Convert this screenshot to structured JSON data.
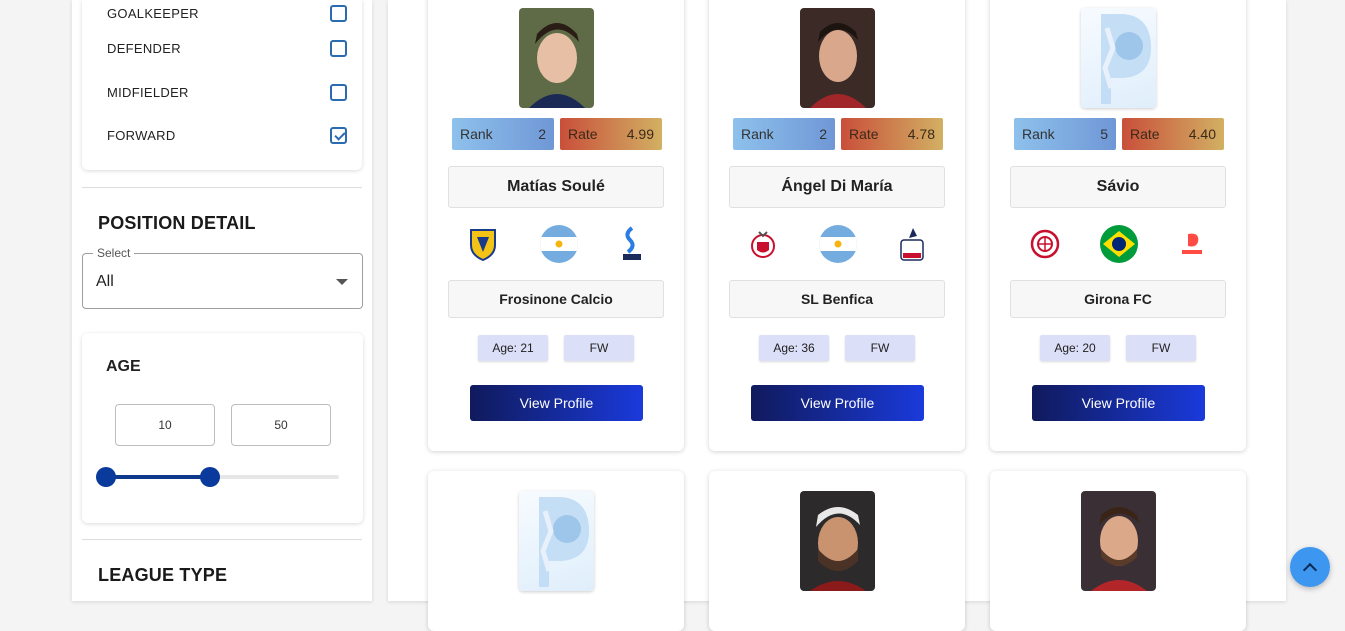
{
  "filters": {
    "positions": [
      {
        "label": "GOALKEEPER",
        "checked": false
      },
      {
        "label": "DEFENDER",
        "checked": false
      },
      {
        "label": "MIDFIELDER",
        "checked": false
      },
      {
        "label": "FORWARD",
        "checked": true
      }
    ],
    "position_detail": {
      "title": "POSITION DETAIL",
      "select_label": "Select",
      "select_value": "All"
    },
    "age": {
      "title": "AGE",
      "min": "10",
      "max": "50"
    },
    "league_type": {
      "title": "LEAGUE TYPE"
    }
  },
  "players": [
    {
      "rank_label": "Rank",
      "rank": "2",
      "rate_label": "Rate",
      "rate": "4.99",
      "name": "Matías Soulé",
      "club": "Frosinone Calcio",
      "age": "Age: 21",
      "position": "FW",
      "button": "View Profile",
      "photo": "player-photo"
    },
    {
      "rank_label": "Rank",
      "rank": "2",
      "rate_label": "Rate",
      "rate": "4.78",
      "name": "Ángel Di María",
      "club": "SL Benfica",
      "age": "Age: 36",
      "position": "FW",
      "button": "View Profile",
      "photo": "player-photo"
    },
    {
      "rank_label": "Rank",
      "rank": "5",
      "rate_label": "Rate",
      "rate": "4.40",
      "name": "Sávio",
      "club": "Girona FC",
      "age": "Age: 20",
      "position": "FW",
      "button": "View Profile",
      "photo": "placeholder-logo"
    }
  ],
  "colors": {
    "accent": "#1a3adb",
    "rank_bg": "#8ec1ec",
    "rate_bg": "#c94f3a",
    "chip_bg": "#dcdff8",
    "checkbox": "#2b6cb0"
  }
}
